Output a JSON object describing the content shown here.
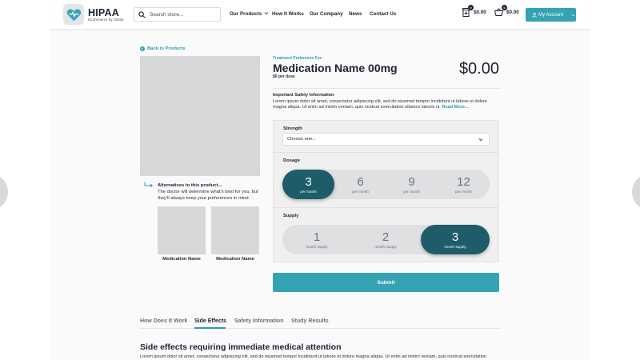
{
  "header": {
    "logo_title": "HIPAA",
    "logo_subtitle": "eCommerce by Clarity",
    "search_placeholder": "Search store...",
    "nav": [
      "Our Products",
      "How It Works",
      "Our Company",
      "News",
      "Contact Us"
    ],
    "cart1": {
      "amount": "$0.00",
      "count": "0"
    },
    "cart2": {
      "amount": "$0.00",
      "count": "0"
    },
    "account_label": "My Account"
  },
  "left": {
    "back_label": "Back to Products",
    "alt_title": "Alternatives to this product...",
    "alt_desc": "The doctor will determine what's best for you, but they'll always keep your preferences in mind.",
    "alternatives": [
      "Medication Name",
      "Medication Name"
    ]
  },
  "product": {
    "pref_label": "Treatment Preference For:",
    "name": "Medication Name 00mg",
    "per_dose": "$0 per dose",
    "price": "$0.00",
    "safety_title": "Important Safety Information",
    "safety_text": "Lorem ipsum dolor sit amet, consectetur adipiscing elit, sed do eiusmod tempor incididunt ut labore et dolore magna aliqua. Ut enim ad minim veniam, quis nostrud exercitation ullamco laboris ni.",
    "read_more": "Read More..."
  },
  "options": {
    "strength_label": "Strength",
    "strength_value": "Choose one...",
    "dosage_label": "Dosage",
    "dosage": [
      {
        "value": "3",
        "unit": "per month"
      },
      {
        "value": "6",
        "unit": "per month"
      },
      {
        "value": "9",
        "unit": "per month"
      },
      {
        "value": "12",
        "unit": "per month"
      }
    ],
    "dosage_selected": "3",
    "supply_label": "Supply",
    "supply": [
      {
        "value": "1",
        "unit": "month supply"
      },
      {
        "value": "2",
        "unit": "month supply"
      },
      {
        "value": "3",
        "unit": "month supply"
      }
    ],
    "supply_selected": "3",
    "submit_label": "Submit"
  },
  "tabs": [
    "How Does It Work",
    "Side Effects",
    "Safety Information",
    "Study Results"
  ],
  "active_tab": "Side Effects",
  "side_effects": {
    "heading": "Side effects requiring immediate medical attention",
    "text": "Lorem ipsum dolor sit amet, consectetur adipiscing elit, sed do eiusmod tempor incididunt ut labore et dolore magna aliqua. Ut enim ad minim veniam, quis nostrud exercitation"
  },
  "colors": {
    "accent": "#35a3b2",
    "selected_pill": "#1d5c68",
    "text_dark": "#1b2232"
  }
}
